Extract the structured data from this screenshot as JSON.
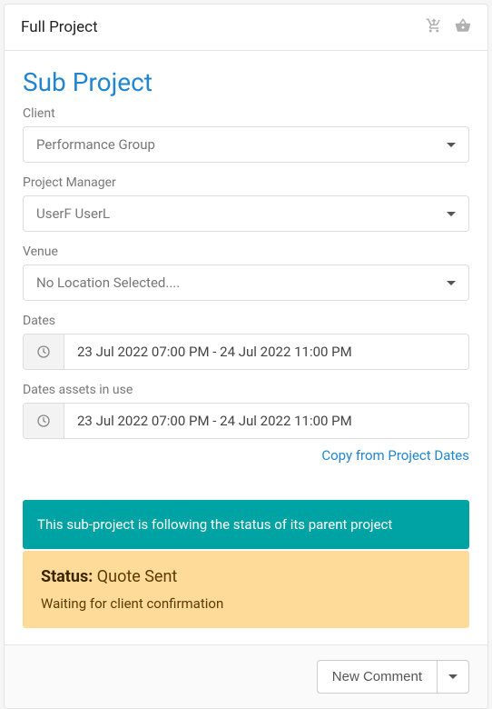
{
  "header": {
    "title": "Full Project"
  },
  "subproject": {
    "title": "Sub Project"
  },
  "labels": {
    "client": "Client",
    "project_manager": "Project Manager",
    "venue": "Venue",
    "dates": "Dates",
    "dates_assets": "Dates assets in use"
  },
  "fields": {
    "client": "Performance Group",
    "project_manager": "UserF UserL",
    "venue": "No Location Selected....",
    "dates": "23 Jul 2022 07:00 PM - 24 Jul 2022 11:00 PM",
    "dates_assets": "23 Jul 2022 07:00 PM - 24 Jul 2022 11:00 PM"
  },
  "links": {
    "copy_dates": "Copy from Project Dates"
  },
  "alerts": {
    "following": "This sub-project is following the status of its parent project",
    "status_label": "Status:",
    "status_value": "Quote Sent",
    "status_desc": "Waiting for client confirmation"
  },
  "footer": {
    "new_comment": "New Comment"
  }
}
